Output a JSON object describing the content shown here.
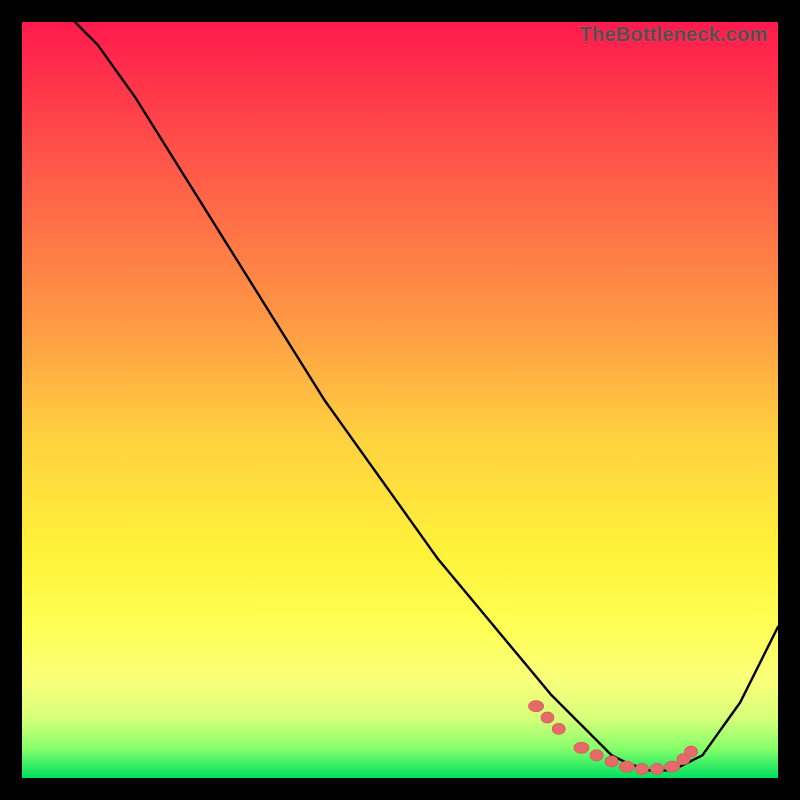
{
  "watermark": "TheBottleneck.com",
  "colors": {
    "curve_stroke": "#000000",
    "marker_fill": "#e76a6a",
    "marker_stroke": "#d85b5b"
  },
  "chart_data": {
    "type": "line",
    "title": "",
    "xlabel": "",
    "ylabel": "",
    "xlim": [
      0,
      100
    ],
    "ylim": [
      0,
      100
    ],
    "x": [
      0,
      5,
      10,
      15,
      20,
      25,
      30,
      35,
      40,
      45,
      50,
      55,
      60,
      65,
      70,
      75,
      78,
      80,
      83,
      86,
      90,
      95,
      100
    ],
    "values": [
      105,
      102,
      97,
      90,
      82,
      74,
      66,
      58,
      50,
      43,
      36,
      29,
      23,
      17,
      11,
      6,
      3,
      2,
      1,
      1,
      3,
      10,
      20
    ],
    "markers_x": [
      68,
      69.5,
      71,
      74,
      76,
      78,
      80,
      82,
      84,
      86,
      87.5,
      88.5
    ],
    "markers_y": [
      9.5,
      8,
      6.5,
      4,
      3,
      2.2,
      1.5,
      1.2,
      1.2,
      1.5,
      2.5,
      3.5
    ]
  }
}
